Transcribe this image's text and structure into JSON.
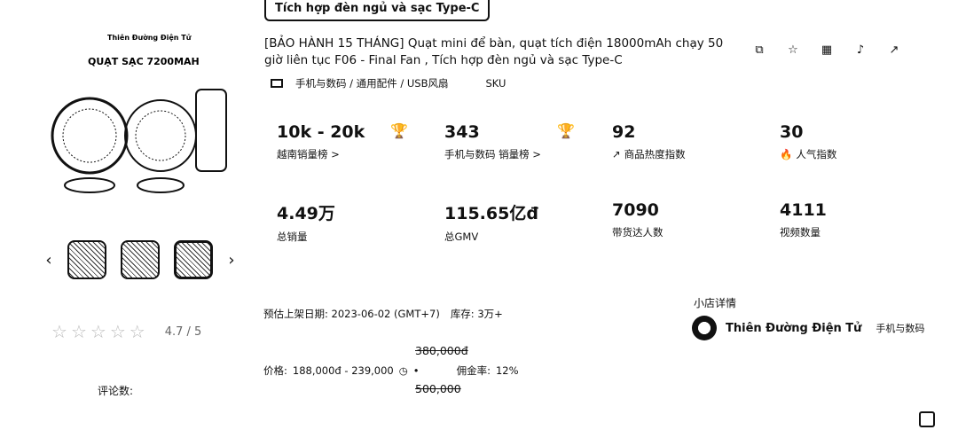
{
  "banner": "Tích hợp đèn ngủ và sạc Type-C",
  "product": {
    "title": "[BẢO HÀNH 15 THÁNG] Quạt mini để bàn, quạt tích điện 18000mAh chạy 50 giờ liên tục F06 - Final Fan , Tích hợp đèn ngủ và sạc Type-C",
    "category": "手机与数码 / 通用配件 / USB风扇",
    "sku_label": "SKU",
    "title_icons": [
      "translate-icon",
      "favorite-icon",
      "qr-icon",
      "tiktok-icon",
      "open-link-icon"
    ]
  },
  "gallery": {
    "image_lines": [
      "Thiên Đường Điện Tử",
      "QUẠT SẠC 7200MAH"
    ],
    "thumb_count": 3
  },
  "rating": {
    "stars": 4.7,
    "value": "4.7",
    "max": "/ 5"
  },
  "reviews_label": "评论数:",
  "stats": [
    {
      "value": "10k - 20k",
      "label": "越南销量榜 >"
    },
    {
      "value": "343",
      "label": "手机与数码 销量榜 >"
    },
    {
      "value": "92",
      "label": "商品热度指数"
    },
    {
      "value": "30",
      "label": "人气指数"
    },
    {
      "value": "4.49万",
      "label": "总销量"
    },
    {
      "value": "115.65亿đ",
      "label": "总GMV"
    },
    {
      "value": "7090",
      "label": "带货达人数"
    },
    {
      "value": "4111",
      "label": "视频数量"
    }
  ],
  "listing": {
    "date_label": "预估上架日期:",
    "date_value": "2023-06-02 (GMT+7)",
    "stock_label": "库存:",
    "stock_value": "3万+"
  },
  "price": {
    "label": "价格:",
    "value": "188,000đ - 239,000",
    "old_top": "380,000đ",
    "old_bottom": "500,000",
    "commission_label": "佣金率:",
    "commission_value": "12%"
  },
  "shop": {
    "header": "小店详情",
    "name": "Thiên Đường Điện Tử",
    "category": "手机与数码"
  }
}
